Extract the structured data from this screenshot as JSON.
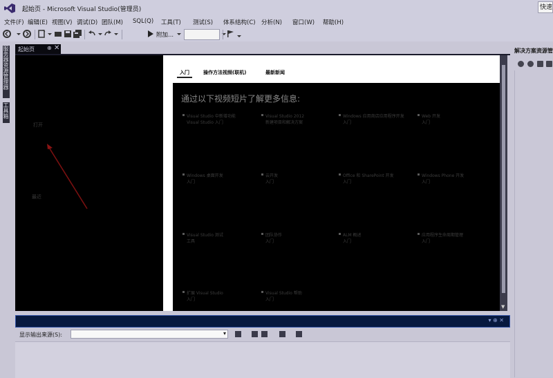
{
  "window": {
    "title": "起始页 - Microsoft Visual Studio(管理员)",
    "quick_launch": "快速"
  },
  "menu": [
    "文件(F)",
    "编辑(E)",
    "视图(V)",
    "调试(D)",
    "团队(M)",
    "SQL(Q)",
    "工具(T)",
    "测试(S)",
    "体系结构(C)",
    "分析(N)",
    "窗口(W)",
    "帮助(H)"
  ],
  "toolbar": {
    "attach_label": "附加...",
    "config_value": ""
  },
  "left_rail": {
    "tab1": "服务器资源管理器",
    "tab2": "工具箱"
  },
  "document_tab": {
    "label": "起始页",
    "pin": "⊕",
    "close": "✕"
  },
  "start_page": {
    "left_links": [
      "打开",
      "最近"
    ],
    "tabs": [
      "入门",
      "操作方法视频(联机)",
      "最新新闻"
    ],
    "videos_title": "通过以下视频短片了解更多信息:",
    "videos": [
      [
        "Visual Studio 中新增功能",
        "Visual Studio 入门"
      ],
      [
        "Visual Studio 2012",
        "新建项目和解决方案"
      ],
      [
        "Windows 应用商店应用程序开发",
        "入门"
      ],
      [
        "Web 开发",
        "入门"
      ],
      [
        "Windows 桌面开发",
        "入门"
      ],
      [
        "云开发",
        "入门"
      ],
      [
        "Office 和 SharePoint 开发",
        "入门"
      ],
      [
        "Windows Phone 开发",
        "入门"
      ],
      [
        "Visual Studio 测试",
        "工具"
      ],
      [
        "团队协作",
        "入门"
      ],
      [
        "ALM 概述",
        "入门"
      ],
      [
        "应用程序生命周期管理",
        "入门"
      ],
      [
        "扩展 Visual Studio",
        "入门"
      ],
      [
        "Visual Studio 帮助",
        "入门"
      ]
    ]
  },
  "solution_explorer": {
    "title": "解决方案资源管理器"
  },
  "output": {
    "header_icons": "▾ ⊕ ✕",
    "show_label": "显示输出来源(S):",
    "source_value": "",
    "dropdown_arrow": "▾"
  }
}
